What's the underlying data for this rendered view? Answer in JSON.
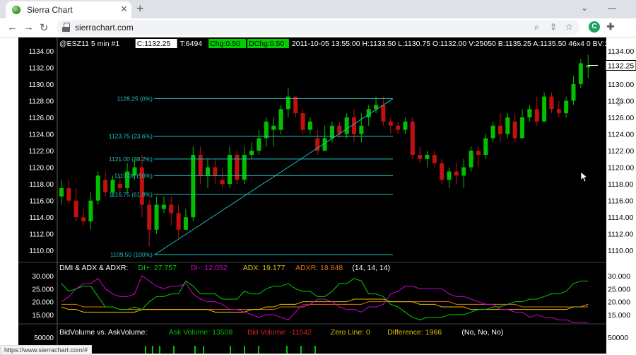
{
  "browser": {
    "tab_title": "Sierra Chart",
    "tab_close": "✕",
    "new_tab": "+",
    "tab_search": "⌄",
    "url": "sierrachart.com",
    "back": "←",
    "forward": "→",
    "reload": "↻",
    "status_url": "https://www.sierrachart.com/#"
  },
  "header": {
    "symbol": "@ESZ11  5 min  #1",
    "close": "C:1132.25",
    "trades": "T:6494",
    "chg": "Chg:0.50",
    "dchg": "DChg:0.50",
    "info": "2011-10-05 13:55:00 H:1133.50 L:1130.75 O:1132.00 V:25050 B:1135.25 A:1135.50 46x4 0 BV:1154"
  },
  "price_axis": {
    "left_labels": [
      "1134.00",
      "1132.00",
      "1130.00",
      "1128.00",
      "1126.00",
      "1124.00",
      "1122.00",
      "1120.00",
      "1118.00",
      "1116.00",
      "1114.00",
      "1112.00",
      "1110.00"
    ],
    "right_labels": [
      "1134.00",
      "1130.00",
      "1128.00",
      "1126.00",
      "1124.00",
      "1122.00",
      "1120.00",
      "1118.00",
      "1116.00",
      "1114.00",
      "1112.00",
      "1110.00"
    ],
    "current_price": "1132.25"
  },
  "fib_levels": [
    {
      "label": "1128.25 (0%)",
      "price": 1128.25
    },
    {
      "label": "1123.75 (23.6%)",
      "price": 1123.75
    },
    {
      "label": "1121.00 (38.2%)",
      "price": 1121.0
    },
    {
      "label": "1119.00 (50%)",
      "price": 1119.0
    },
    {
      "label": "1116.75 (61.8%)",
      "price": 1116.75
    },
    {
      "label": "1109.50 (100%)",
      "price": 1109.5
    }
  ],
  "dmi_panel": {
    "title": "DMI & ADX & ADXR:",
    "di_plus": "DI+: 27.757",
    "di_minus": "DI-: 12.052",
    "adx": "ADX: 19.177",
    "adxr": "ADXR: 18.848",
    "params": "(14, 14, 14)",
    "labels": [
      "30.000",
      "25.000",
      "20.000",
      "15.000"
    ],
    "right_labels": [
      "30.000",
      "25.000",
      "20.000",
      "15.000"
    ]
  },
  "volume_panel": {
    "title": "BidVolume vs. AskVolume:",
    "ask": "Ask Volume: 13508",
    "bid": "Bid Volume: -11542",
    "zero": "Zero Line: 0",
    "diff": "Difference: 1966",
    "params": "(No, No, No)",
    "label": "50000",
    "right_label": "50000"
  },
  "colors": {
    "up": "#00c000",
    "down": "#c01010",
    "fib": "#20c0c0",
    "di_plus": "#00d000",
    "di_minus": "#d000d0",
    "adx": "#e0c000",
    "adxr": "#e07010"
  },
  "candles": [
    [
      1116.5,
      1117.5,
      1118.5,
      1115.5
    ],
    [
      1117.5,
      1116.0,
      1118.5,
      1115.5
    ],
    [
      1116.0,
      1114.0,
      1117.5,
      1113.5
    ],
    [
      1114.0,
      1113.5,
      1115.0,
      1113.0
    ],
    [
      1113.5,
      1116.0,
      1117.0,
      1112.5
    ],
    [
      1116.0,
      1119.0,
      1119.5,
      1115.5
    ],
    [
      1118.5,
      1117.0,
      1119.5,
      1116.5
    ],
    [
      1117.0,
      1118.5,
      1119.0,
      1116.5
    ],
    [
      1118.0,
      1117.5,
      1119.0,
      1117.0
    ],
    [
      1117.5,
      1119.5,
      1120.5,
      1117.0
    ],
    [
      1119.0,
      1120.0,
      1121.0,
      1118.5
    ],
    [
      1120.0,
      1115.5,
      1121.5,
      1114.0
    ],
    [
      1115.5,
      1112.5,
      1116.0,
      1110.5
    ],
    [
      1112.5,
      1115.5,
      1116.5,
      1112.0
    ],
    [
      1115.0,
      1115.5,
      1116.5,
      1114.5
    ],
    [
      1115.5,
      1114.5,
      1116.5,
      1113.0
    ],
    [
      1114.5,
      1112.5,
      1115.5,
      1111.5
    ],
    [
      1112.5,
      1114.0,
      1115.0,
      1112.5
    ],
    [
      1114.0,
      1121.5,
      1122.5,
      1113.5
    ],
    [
      1121.5,
      1119.0,
      1122.5,
      1118.0
    ],
    [
      1119.0,
      1120.0,
      1121.0,
      1117.5
    ],
    [
      1120.0,
      1119.0,
      1121.0,
      1118.0
    ],
    [
      1118.5,
      1118.0,
      1120.0,
      1117.5
    ],
    [
      1118.0,
      1121.5,
      1122.5,
      1117.5
    ],
    [
      1121.5,
      1118.5,
      1122.0,
      1118.0
    ],
    [
      1118.5,
      1121.5,
      1122.5,
      1118.0
    ],
    [
      1121.5,
      1122.0,
      1123.0,
      1121.0
    ],
    [
      1122.0,
      1123.5,
      1124.5,
      1121.5
    ],
    [
      1123.5,
      1125.5,
      1126.0,
      1122.5
    ],
    [
      1124.5,
      1125.0,
      1126.0,
      1122.5
    ],
    [
      1124.5,
      1127.0,
      1127.5,
      1124.0
    ],
    [
      1127.0,
      1128.5,
      1129.5,
      1126.0
    ],
    [
      1128.5,
      1126.5,
      1128.5,
      1126.0
    ],
    [
      1126.5,
      1124.5,
      1127.0,
      1124.0
    ],
    [
      1124.5,
      1125.5,
      1126.0,
      1124.0
    ],
    [
      1123.5,
      1122.0,
      1124.5,
      1121.5
    ],
    [
      1122.0,
      1123.5,
      1125.0,
      1122.0
    ],
    [
      1123.5,
      1125.0,
      1125.5,
      1123.0
    ],
    [
      1125.0,
      1124.0,
      1125.5,
      1123.5
    ],
    [
      1124.0,
      1126.0,
      1126.5,
      1123.5
    ],
    [
      1126.0,
      1124.0,
      1127.0,
      1123.0
    ],
    [
      1124.0,
      1125.0,
      1126.5,
      1123.0
    ],
    [
      1126.0,
      1127.0,
      1127.5,
      1125.0
    ],
    [
      1127.0,
      1127.5,
      1128.5,
      1126.5
    ],
    [
      1127.5,
      1125.5,
      1128.5,
      1125.0
    ],
    [
      1125.5,
      1125.0,
      1126.0,
      1124.0
    ],
    [
      1125.0,
      1124.5,
      1125.5,
      1124.0
    ],
    [
      1124.5,
      1125.5,
      1126.0,
      1124.0
    ],
    [
      1125.5,
      1121.5,
      1126.0,
      1121.0
    ],
    [
      1121.5,
      1121.0,
      1122.5,
      1120.5
    ],
    [
      1121.0,
      1121.5,
      1122.0,
      1120.0
    ],
    [
      1121.5,
      1120.5,
      1122.0,
      1120.0
    ],
    [
      1120.5,
      1118.5,
      1121.0,
      1118.0
    ],
    [
      1118.5,
      1119.5,
      1120.0,
      1117.5
    ],
    [
      1119.5,
      1119.0,
      1120.5,
      1118.0
    ],
    [
      1119.0,
      1120.0,
      1121.0,
      1117.5
    ],
    [
      1120.0,
      1122.0,
      1122.5,
      1119.5
    ],
    [
      1122.0,
      1121.5,
      1122.5,
      1120.0
    ],
    [
      1121.5,
      1123.5,
      1124.0,
      1121.0
    ],
    [
      1123.5,
      1125.0,
      1125.5,
      1123.0
    ],
    [
      1125.0,
      1124.0,
      1126.5,
      1123.0
    ],
    [
      1124.0,
      1126.0,
      1126.5,
      1123.5
    ],
    [
      1125.5,
      1123.5,
      1126.5,
      1123.0
    ],
    [
      1123.5,
      1126.0,
      1127.0,
      1123.5
    ],
    [
      1126.0,
      1127.0,
      1127.5,
      1125.5
    ],
    [
      1127.0,
      1125.5,
      1128.5,
      1125.0
    ],
    [
      1125.5,
      1128.5,
      1129.0,
      1125.5
    ],
    [
      1128.5,
      1127.0,
      1129.0,
      1126.5
    ],
    [
      1127.0,
      1126.5,
      1128.0,
      1126.0
    ],
    [
      1126.5,
      1128.0,
      1128.5,
      1126.0
    ],
    [
      1128.0,
      1130.0,
      1131.0,
      1127.5
    ],
    [
      1130.0,
      1132.5,
      1133.0,
      1129.5
    ],
    [
      1132.0,
      1132.25,
      1133.5,
      1130.75
    ]
  ],
  "dmi_series": {
    "di_plus": [
      27,
      24,
      25,
      26,
      26,
      22,
      18,
      18,
      17,
      17,
      18,
      17,
      20,
      22,
      22,
      23,
      23,
      28,
      26,
      23,
      23,
      23,
      21,
      21,
      21,
      24,
      23,
      23,
      25,
      26,
      26,
      27,
      25,
      24,
      24,
      22,
      22,
      24,
      27,
      27,
      29,
      28,
      23,
      23,
      22,
      19,
      18,
      16,
      14,
      13,
      14,
      14,
      14,
      15,
      15,
      15,
      16,
      17,
      17,
      18,
      18,
      19,
      20,
      20,
      21,
      21,
      22,
      23,
      23,
      24,
      27,
      28,
      28
    ],
    "di_minus": [
      20,
      22,
      25,
      27,
      27,
      29,
      25,
      23,
      22,
      22,
      23,
      30,
      28,
      26,
      25,
      26,
      26,
      27,
      23,
      21,
      20,
      20,
      19,
      17,
      17,
      16,
      15,
      14,
      15,
      15,
      14,
      13,
      16,
      19,
      19,
      21,
      21,
      20,
      18,
      17,
      17,
      16,
      18,
      18,
      19,
      23,
      24,
      26,
      26,
      25,
      25,
      25,
      25,
      23,
      22,
      22,
      21,
      20,
      19,
      19,
      17,
      17,
      16,
      16,
      14,
      15,
      14,
      14,
      13,
      13,
      12,
      12,
      12
    ],
    "adx": [
      18,
      17,
      17,
      16,
      16,
      16,
      16,
      16,
      16,
      16,
      16,
      17,
      17,
      17,
      17,
      17,
      17,
      17,
      17,
      17,
      17,
      16,
      16,
      16,
      16,
      16,
      17,
      17,
      18,
      18,
      19,
      19,
      19,
      20,
      20,
      20,
      20,
      20,
      20,
      20,
      21,
      21,
      21,
      21,
      21,
      20,
      20,
      20,
      20,
      19,
      19,
      19,
      18,
      18,
      18,
      18,
      17,
      17,
      17,
      17,
      17,
      17,
      17,
      17,
      17,
      17,
      17,
      17,
      17,
      17,
      18,
      18,
      19
    ],
    "adxr": [
      19,
      19,
      19,
      18,
      18,
      18,
      18,
      18,
      17,
      17,
      17,
      17,
      17,
      17,
      17,
      17,
      17,
      17,
      17,
      17,
      17,
      17,
      17,
      17,
      17,
      17,
      17,
      17,
      17,
      17,
      18,
      18,
      18,
      18,
      19,
      19,
      19,
      19,
      19,
      19,
      19,
      19,
      20,
      20,
      20,
      20,
      20,
      20,
      20,
      20,
      20,
      20,
      20,
      20,
      19,
      19,
      19,
      19,
      19,
      19,
      19,
      19,
      19,
      18,
      18,
      18,
      18,
      18,
      18,
      18,
      18,
      18,
      18
    ]
  },
  "volume_bars": [
    0,
    0,
    0,
    0,
    0,
    0,
    0,
    0,
    0,
    0,
    0,
    0,
    0,
    0,
    0,
    0,
    0,
    0,
    0,
    0,
    0,
    0,
    0,
    0,
    0,
    0,
    0,
    0,
    0,
    0,
    0,
    0,
    0,
    0,
    0,
    0,
    0,
    0,
    0,
    0,
    0,
    0,
    0,
    0,
    0,
    0,
    0,
    0,
    0,
    0,
    0,
    0,
    0,
    0,
    0,
    0,
    0,
    0,
    0,
    0,
    0,
    0,
    0,
    0,
    0,
    0,
    0,
    0,
    0,
    0,
    0,
    0,
    0
  ]
}
